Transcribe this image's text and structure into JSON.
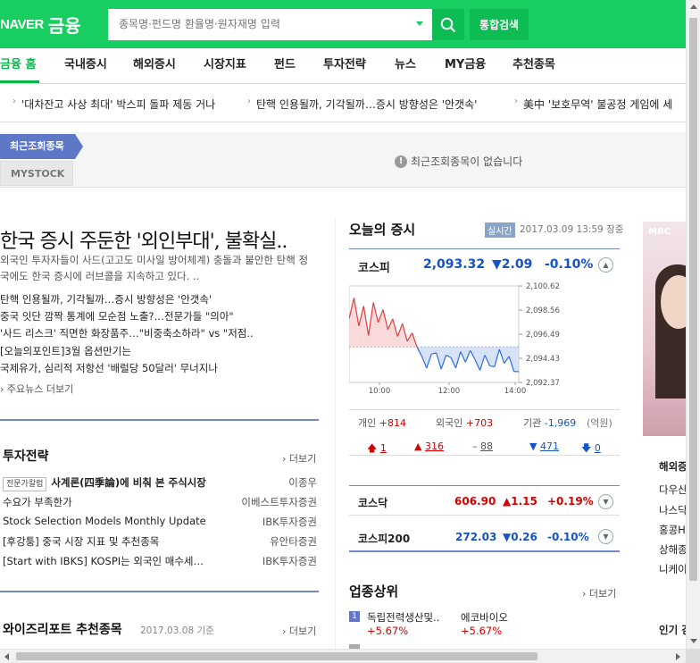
{
  "header": {
    "brand": "NAVER",
    "service": "금융",
    "search_placeholder": "종목명·펀드명 환율명·원자재명 입력",
    "total_search": "통합검색"
  },
  "gnb": [
    {
      "label": "금융 홈",
      "active": true
    },
    {
      "label": "국내증시"
    },
    {
      "label": "해외증시"
    },
    {
      "label": "시장지표"
    },
    {
      "label": "펀드"
    },
    {
      "label": "투자전략"
    },
    {
      "label": "뉴스"
    },
    {
      "label": "MY금융"
    },
    {
      "label": "추천종목"
    }
  ],
  "ticker": [
    "'대차잔고 사상 최대' 박스피 돌파 제동 거나",
    "탄핵 인용될까, 기각될까…증시 방향성은 '안갯속'",
    "美中 '보호무역' 불공정 게임에 세"
  ],
  "recent": {
    "tab": "최근조회종목",
    "mystock": "MYSTOCK",
    "empty": "최근조회종목이 없습니다"
  },
  "news": {
    "headline": "한국 증시 주둔한 '외인부대', 불확실..",
    "summary": "외국인 투자자들이 사드(고고도 미사일 방어체계) 충돌과 불안한 탄핵 정국에도 한국 증시에 러브콜을 지속하고 있다. ..",
    "items": [
      "탄핵 인용될까, 기각될까…증시 방향성은 '안갯속'",
      "중국 잇단 깜짝 통계에 모순점 노출?…전문가들 \"의아\"",
      "'사드 리스크' 직면한 화장품주…\"비중축소하라\" vs \"저점..",
      "[오늘의포인트]3월 옵션만기는",
      "국제유가, 심리적 저항선 '배럴당 50달러' 무너지나"
    ],
    "more": "주요뉴스 더보기"
  },
  "strategy": {
    "title": "투자전략",
    "more": "더보기",
    "rows": [
      {
        "badge": "전문가칼럼",
        "title": "사계론(四季論)에 비춰 본 주식시장",
        "source": "이종우"
      },
      {
        "title": "수요가 부족한가",
        "source": "이베스트투자증권"
      },
      {
        "title": "Stock Selection Models Monthly Update",
        "source": "IBK투자증권"
      },
      {
        "title": "[후강퉁] 중국 시장 지표 및 추천종목",
        "source": "유안타증권"
      },
      {
        "title": "[Start with IBKS] KOSPI는 외국인 매수세…",
        "source": "IBK투자증권"
      }
    ]
  },
  "wise": {
    "title": "와이즈리포트 추천종목",
    "date": "2017.03.08 기준",
    "more": "더보기"
  },
  "market": {
    "title": "오늘의 증시",
    "live": "실시간",
    "time": "2017.03.09 13:59",
    "status": "장중",
    "kospi": {
      "name": "코스피",
      "value": "2,093.32",
      "change": "▼2.09",
      "pct": "-0.10%"
    },
    "investors": {
      "personal_label": "개인",
      "personal": "+814",
      "foreign_label": "외국인",
      "foreign": "+703",
      "inst_label": "기관",
      "inst": "-1,969",
      "unit": "(억원)"
    },
    "breadth": {
      "upper": "1",
      "up": "316",
      "flat": "88",
      "down": "471",
      "lower": "0"
    },
    "kosdaq": {
      "name": "코스닥",
      "value": "606.90",
      "change": "▲1.15",
      "pct": "+0.19%"
    },
    "kospi200": {
      "name": "코스피200",
      "value": "272.03",
      "change": "▼0.26",
      "pct": "-0.10%"
    }
  },
  "chart_data": {
    "type": "line",
    "x_ticks": [
      "10:00",
      "12:00",
      "14:00"
    ],
    "y_ticks": [
      "2,100.62",
      "2,098.56",
      "2,096.49",
      "2,094.43",
      "2,092.37"
    ],
    "ylim": [
      2092.37,
      2100.62
    ],
    "reference": 2095.41,
    "values": [
      2097.8,
      2099.6,
      2097.2,
      2098.9,
      2096.4,
      2099.2,
      2097.5,
      2098.6,
      2096.9,
      2097.8,
      2096.3,
      2097.4,
      2095.9,
      2096.6,
      2095.4,
      2094.6,
      2093.6,
      2094.8,
      2094.9,
      2093.5,
      2094.7,
      2094.5,
      2093.6,
      2095.0,
      2094.1,
      2095.1,
      2094.3,
      2093.4,
      2094.7,
      2093.8,
      2093.7,
      2095.2,
      2094.0,
      2094.6,
      2093.3,
      2093.3
    ]
  },
  "rank": {
    "title": "업종상위",
    "more": "더보기",
    "items": [
      {
        "rank": "1",
        "name": "독립전력생산및..",
        "pct": "+5.67%",
        "top": "에코바이오",
        "top_pct": "+5.67%"
      }
    ]
  },
  "side": {
    "ad_logo": "MBC",
    "title": "해외증",
    "items": [
      "다우산",
      "나스닥",
      "홍콩H",
      "상해종",
      "니케이"
    ],
    "title2": "인기 검"
  }
}
